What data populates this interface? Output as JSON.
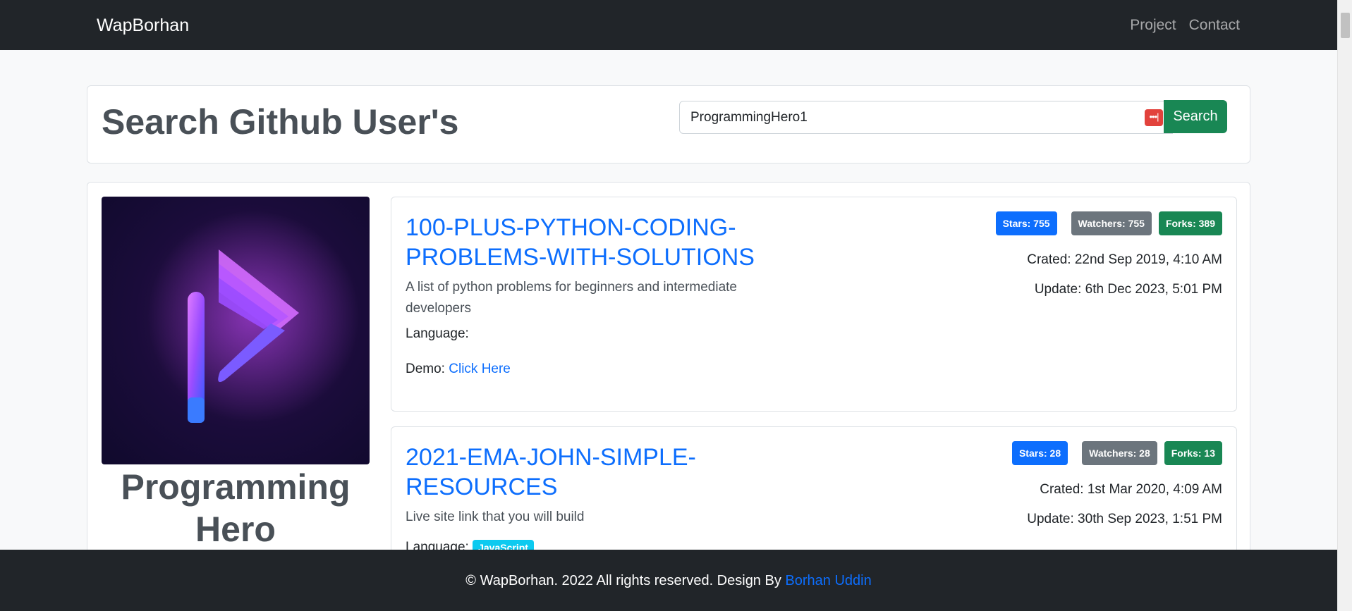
{
  "navbar": {
    "brand": "WapBorhan",
    "links": [
      "Project",
      "Contact"
    ]
  },
  "search": {
    "title": "Search Github User's",
    "input_value": "ProgrammingHero1",
    "button_label": "Search"
  },
  "user": {
    "name": "Programming Hero"
  },
  "repos": [
    {
      "name": "100-PLUS-PYTHON-CODING-PROBLEMS-WITH-SOLUTIONS",
      "description": "A list of python problems for beginners and intermediate developers",
      "language_label": "Language:",
      "language": "",
      "demo_label": "Demo:",
      "demo_link": "Click Here",
      "stars": "Stars: 755",
      "watchers": "Watchers: 755",
      "forks": "Forks: 389",
      "created": "Crated: 22nd Sep 2019, 4:10 AM",
      "updated": "Update: 6th Dec 2023, 5:01 PM"
    },
    {
      "name": "2021-EMA-JOHN-SIMPLE-RESOURCES",
      "description": "Live site link that you will build",
      "language_label": "Language:",
      "language": "JavaScript",
      "stars": "Stars: 28",
      "watchers": "Watchers: 28",
      "forks": "Forks: 13",
      "created": "Crated: 1st Mar 2020, 4:09 AM",
      "updated": "Update: 30th Sep 2023, 1:51 PM"
    }
  ],
  "footer": {
    "text": "© WapBorhan. 2022 All rights reserved. Design By",
    "author_link": "Borhan Uddin"
  },
  "colors": {
    "navbar_bg": "#212529",
    "primary": "#0d6efd",
    "success": "#198754",
    "secondary": "#6c757d",
    "info": "#0dcaf0"
  },
  "icons": [
    "password-manager-icon",
    "programming-hero-logo"
  ]
}
